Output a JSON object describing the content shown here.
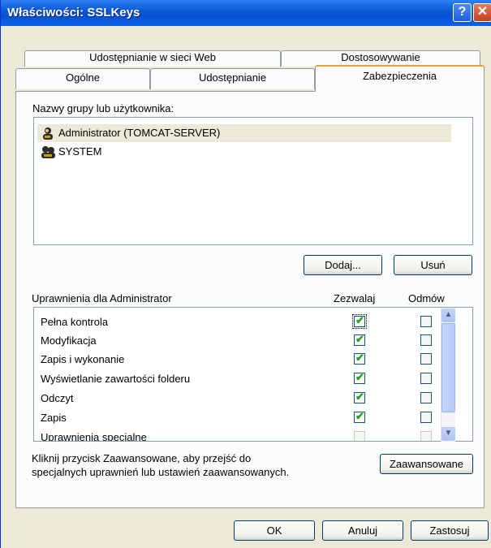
{
  "window": {
    "title": "Właściwości: SSLKeys"
  },
  "tabs": {
    "row1": [
      "Udostępnianie w sieci Web",
      "Dostosowywanie"
    ],
    "row2": [
      "Ogólne",
      "Udostępnianie",
      "Zabezpieczenia"
    ],
    "active": "Zabezpieczenia"
  },
  "security": {
    "users_label": "Nazwy grupy lub użytkownika:",
    "users": [
      {
        "name": "Administrator (TOMCAT-SERVER)",
        "icon": "user-icon",
        "selected": true
      },
      {
        "name": "SYSTEM",
        "icon": "group-icon",
        "selected": false
      }
    ],
    "add_button": "Dodaj...",
    "remove_button": "Usuń",
    "permissions_label": "Uprawnienia dla Administrator",
    "allow_header": "Zezwalaj",
    "deny_header": "Odmów",
    "permissions": [
      {
        "name": "Pełna kontrola",
        "allow": true,
        "deny": false
      },
      {
        "name": "Modyfikacja",
        "allow": true,
        "deny": false
      },
      {
        "name": "Zapis i wykonanie",
        "allow": true,
        "deny": false
      },
      {
        "name": "Wyświetlanie zawartości folderu",
        "allow": true,
        "deny": false
      },
      {
        "name": "Odczyt",
        "allow": true,
        "deny": false
      },
      {
        "name": "Zapis",
        "allow": true,
        "deny": false
      },
      {
        "name": "Uprawnienia specjalne",
        "allow": false,
        "deny": false
      }
    ],
    "advanced_text": "Kliknij przycisk Zaawansowane, aby przejść do specjalnych uprawnień lub ustawień zaawansowanych.",
    "advanced_button": "Zaawansowane"
  },
  "buttons": {
    "ok": "OK",
    "cancel": "Anuluj",
    "apply": "Zastosuj"
  },
  "colors": {
    "titlebar": "#0a5bd8",
    "checkmark": "#21a121",
    "selection": "#ece9d8"
  }
}
